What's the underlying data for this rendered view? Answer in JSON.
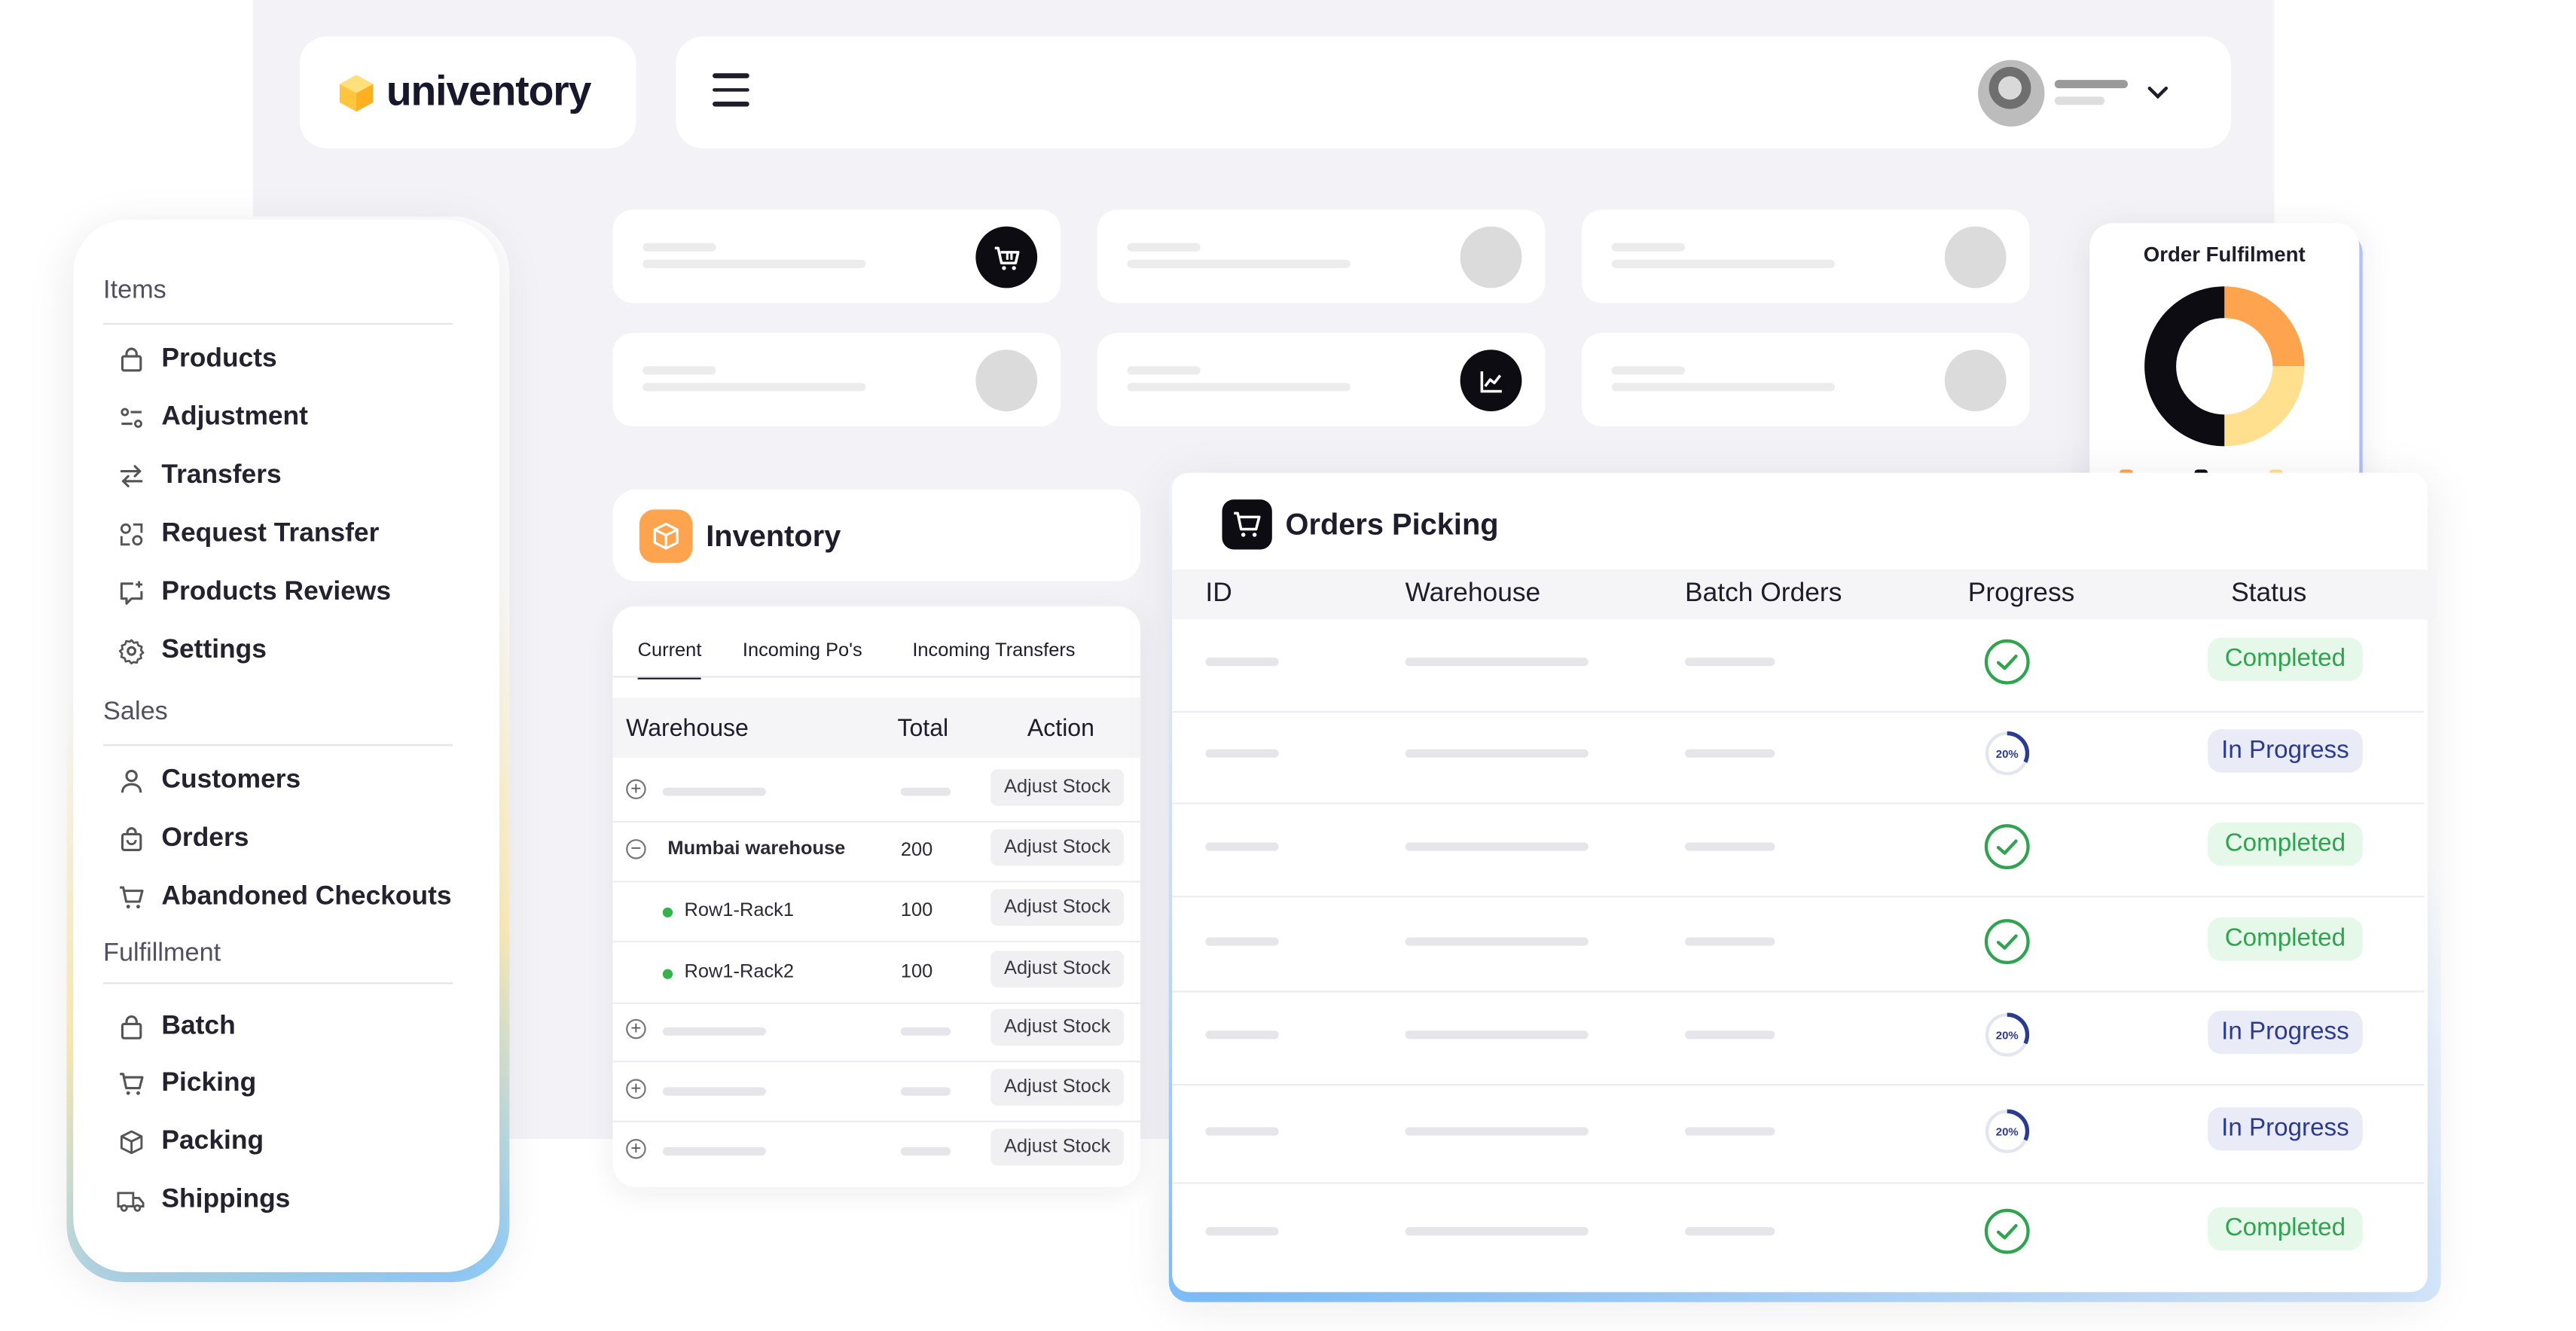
{
  "brand": {
    "name": "univentory"
  },
  "sidebar": {
    "sections": [
      {
        "title": "Items",
        "items": [
          {
            "label": "Products",
            "icon": "bag-icon"
          },
          {
            "label": "Adjustment",
            "icon": "adjust-icon"
          },
          {
            "label": "Transfers",
            "icon": "transfer-arrows-icon"
          },
          {
            "label": "Request Transfer",
            "icon": "request-transfer-icon"
          },
          {
            "label": "Products Reviews",
            "icon": "review-icon"
          },
          {
            "label": "Settings",
            "icon": "gear-icon"
          }
        ]
      },
      {
        "title": "Sales",
        "items": [
          {
            "label": "Customers",
            "icon": "user-icon"
          },
          {
            "label": "Orders",
            "icon": "orders-bag-icon"
          },
          {
            "label": "Abandoned Checkouts",
            "icon": "cart-icon"
          }
        ]
      },
      {
        "title": "Fulfillment",
        "items": [
          {
            "label": "Batch",
            "icon": "bag-icon"
          },
          {
            "label": "Picking",
            "icon": "cart-icon"
          },
          {
            "label": "Packing",
            "icon": "box-icon"
          },
          {
            "label": "Shippings",
            "icon": "truck-icon"
          }
        ]
      }
    ]
  },
  "order_fulfilment": {
    "title": "Order Fulfilment",
    "segments": [
      {
        "color": "#ffa44e",
        "fraction": 0.25
      },
      {
        "color": "#ffe08f",
        "fraction": 0.25
      },
      {
        "color": "#0c0c12",
        "fraction": 0.5
      }
    ]
  },
  "inventory": {
    "title": "Inventory",
    "tabs": [
      {
        "label": "Current",
        "active": true
      },
      {
        "label": "Incoming Po's",
        "active": false
      },
      {
        "label": "Incoming Transfers",
        "active": false
      }
    ],
    "columns": [
      "Warehouse",
      "Total",
      "Action"
    ],
    "rows": [
      {
        "kind": "collapsed",
        "name": "",
        "total": "",
        "action": "Adjust Stock"
      },
      {
        "kind": "expanded",
        "name": "Mumbai warehouse",
        "total": "200",
        "action": "Adjust Stock"
      },
      {
        "kind": "child",
        "name": "Row1-Rack1",
        "total": "100",
        "action": "Adjust Stock"
      },
      {
        "kind": "child",
        "name": "Row1-Rack2",
        "total": "100",
        "action": "Adjust Stock"
      },
      {
        "kind": "collapsed",
        "name": "",
        "total": "",
        "action": "Adjust Stock"
      },
      {
        "kind": "collapsed",
        "name": "",
        "total": "",
        "action": "Adjust Stock"
      },
      {
        "kind": "collapsed",
        "name": "",
        "total": "",
        "action": "Adjust Stock"
      }
    ]
  },
  "orders": {
    "title": "Orders Picking",
    "columns": [
      "ID",
      "Warehouse",
      "Batch Orders",
      "Progress",
      "Status"
    ],
    "rows": [
      {
        "progress": "done",
        "status": "Completed"
      },
      {
        "progress": "20%",
        "progress_value": 0.2,
        "status": "In Progress"
      },
      {
        "progress": "done",
        "status": "Completed"
      },
      {
        "progress": "done",
        "status": "Completed"
      },
      {
        "progress": "20%",
        "progress_value": 0.2,
        "status": "In Progress"
      },
      {
        "progress": "20%",
        "progress_value": 0.2,
        "status": "In Progress"
      },
      {
        "progress": "done",
        "status": "Completed"
      }
    ]
  }
}
